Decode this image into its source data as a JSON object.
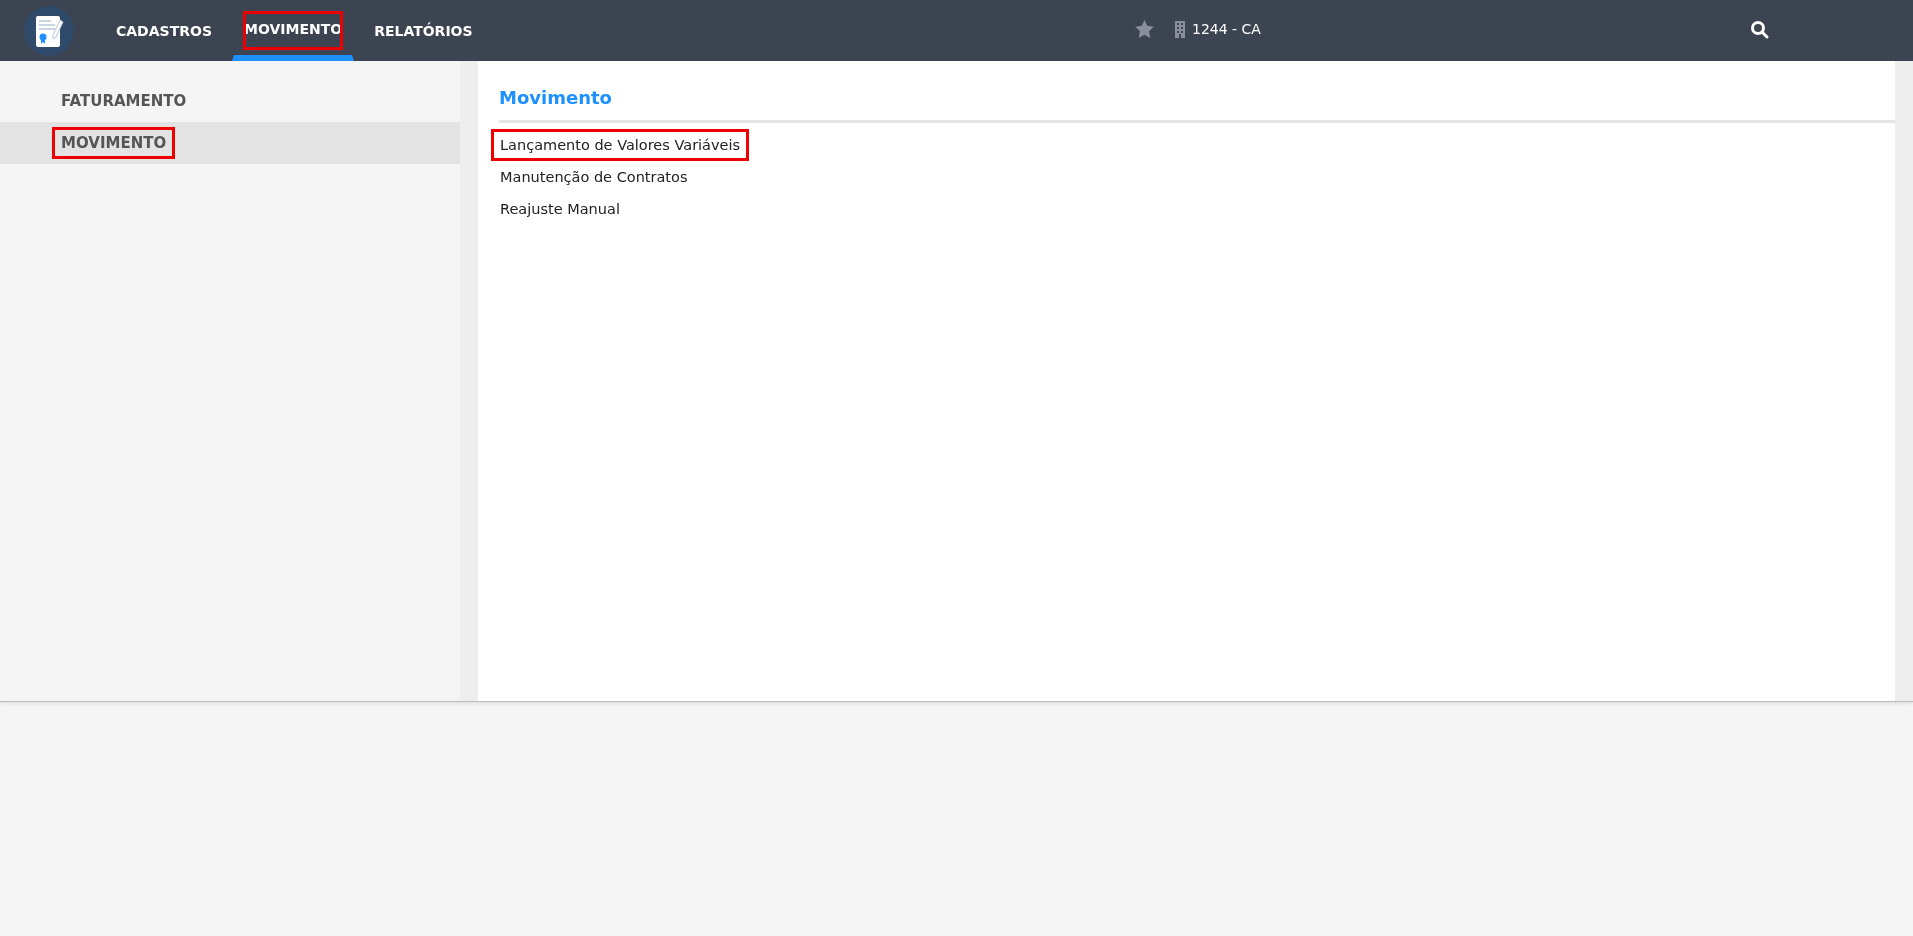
{
  "nav": {
    "tabs": [
      {
        "label": "CADASTROS",
        "selected": false,
        "highlighted": false
      },
      {
        "label": "MOVIMENTO",
        "selected": true,
        "highlighted": true
      },
      {
        "label": "RELATÓRIOS",
        "selected": false,
        "highlighted": false
      }
    ],
    "company": "1244 - CA"
  },
  "sidebar": {
    "items": [
      {
        "label": "FATURAMENTO",
        "selected": false,
        "highlighted": false
      },
      {
        "label": "MOVIMENTO",
        "selected": true,
        "highlighted": true
      }
    ]
  },
  "content": {
    "title": "Movimento",
    "links": [
      {
        "label": "Lançamento de Valores Variáveis",
        "highlighted": true
      },
      {
        "label": "Manutenção de Contratos",
        "highlighted": false
      },
      {
        "label": "Reajuste Manual",
        "highlighted": false
      }
    ]
  }
}
